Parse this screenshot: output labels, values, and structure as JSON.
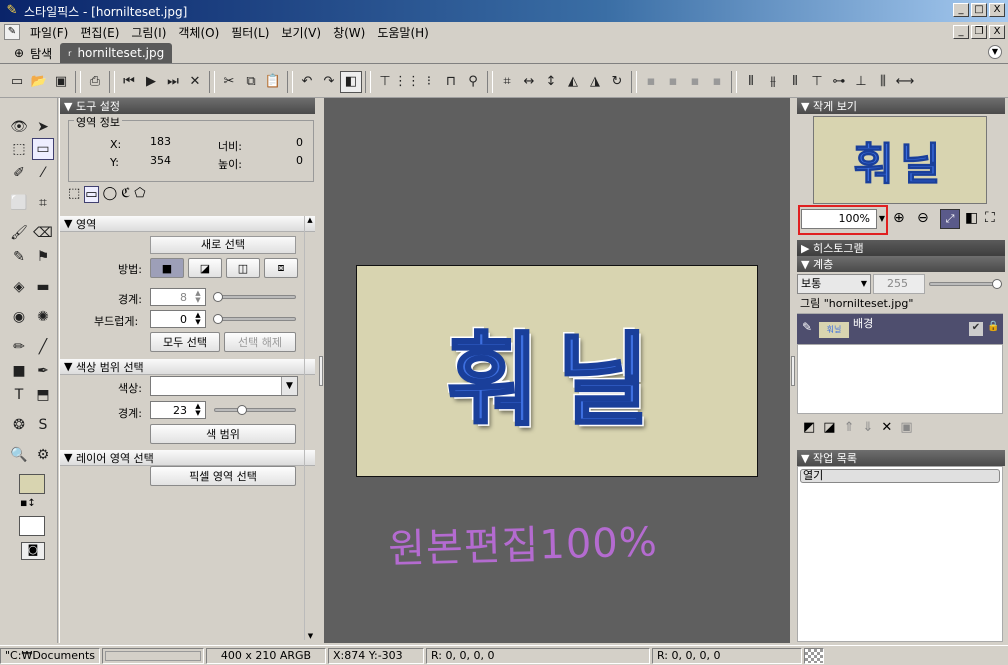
{
  "window": {
    "title": "스타일픽스 - [hornilteset.jpg]",
    "min": "_",
    "max": "□",
    "close": "X"
  },
  "menu": [
    "파일(F)",
    "편집(E)",
    "그림(I)",
    "객체(O)",
    "필터(L)",
    "보기(V)",
    "창(W)",
    "도움말(H)"
  ],
  "tabs": {
    "explore": "탐색",
    "file": "hornilteset.jpg"
  },
  "tool_settings": {
    "title": "도구 설정",
    "area_info": {
      "label": "영역 정보",
      "x_label": "X:",
      "x": "183",
      "y_label": "Y:",
      "y": "354",
      "w_label": "너비:",
      "w": "0",
      "h_label": "높이:",
      "h": "0"
    },
    "region": {
      "header": "영역",
      "new_selection": "새로 선택",
      "method_label": "방법:",
      "border_label": "경계:",
      "border_value": "8",
      "feather_label": "부드럽게:",
      "feather_value": "0",
      "select_all": "모두 선택",
      "deselect": "선택 해제"
    },
    "color_range": {
      "header": "색상 범위 선택",
      "color_label": "색상:",
      "border_label": "경계:",
      "border_value": "23",
      "button": "색 범위"
    },
    "layer_region": {
      "header": "레이어 영역 선택",
      "button": "픽셀 영역 선택"
    }
  },
  "canvas": {
    "image_text": "훠닐",
    "handwriting": "원본편집100%",
    "bg_color": "#d8d4b0",
    "text_color": "#3d6fe0"
  },
  "right": {
    "thumb_title": "작게 보기",
    "thumb_text": "훠닐",
    "zoom": "100%",
    "histogram": "히스토그램",
    "layers": {
      "title": "계층",
      "blend": "보통",
      "opacity": "255",
      "image_label": "그림 \"hornilteset.jpg\"",
      "layer_name": "배경",
      "layer_thumb": "훠닐"
    },
    "history": {
      "title": "작업 목록",
      "item": "열기"
    }
  },
  "status": {
    "path": "\"C:₩Documents a",
    "dims": "400 x 210 ARGB",
    "coords": "X:874 Y:-303",
    "rgb1": "R: 0, 0, 0, 0",
    "rgb2": "R: 0, 0, 0, 0"
  }
}
